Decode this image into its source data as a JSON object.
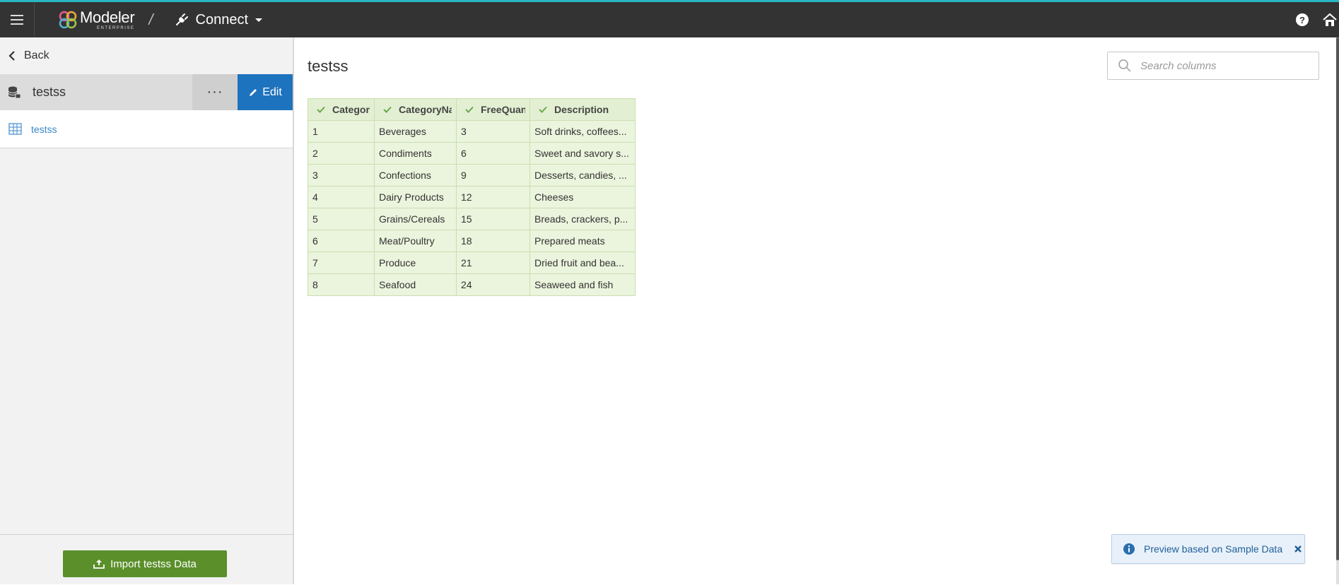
{
  "topbar": {
    "brand_name": "Modeler",
    "brand_sub": "ENTERPRISE",
    "separator": "/",
    "section_label": "Connect"
  },
  "sidebar": {
    "back_label": "Back",
    "datasource_name": "testss",
    "more_label": "···",
    "edit_label": "Edit",
    "tables": [
      {
        "label": "testss"
      }
    ],
    "import_label": "Import testss Data"
  },
  "main": {
    "title": "testss",
    "search_placeholder": "Search columns",
    "columns": [
      {
        "label": "CategoryID"
      },
      {
        "label": "CategoryName"
      },
      {
        "label": "FreeQuantity"
      },
      {
        "label": "Description"
      }
    ],
    "rows": [
      [
        "1",
        "Beverages",
        "3",
        "Soft drinks, coffees..."
      ],
      [
        "2",
        "Condiments",
        "6",
        "Sweet and savory s..."
      ],
      [
        "3",
        "Confections",
        "9",
        "Desserts, candies, ..."
      ],
      [
        "4",
        "Dairy Products",
        "12",
        "Cheeses"
      ],
      [
        "5",
        "Grains/Cereals",
        "15",
        "Breads, crackers, p..."
      ],
      [
        "6",
        "Meat/Poultry",
        "18",
        "Prepared meats"
      ],
      [
        "7",
        "Produce",
        "21",
        "Dried fruit and bea..."
      ],
      [
        "8",
        "Seafood",
        "24",
        "Seaweed and fish"
      ]
    ]
  },
  "toast": {
    "text": "Preview based on Sample Data"
  },
  "colors": {
    "accent": "#29b6c5",
    "topbar": "#333333",
    "edit_button": "#1e73be",
    "import_button": "#5a8f2a",
    "table_bg": "#ebf4dd",
    "link": "#3a86c8"
  }
}
